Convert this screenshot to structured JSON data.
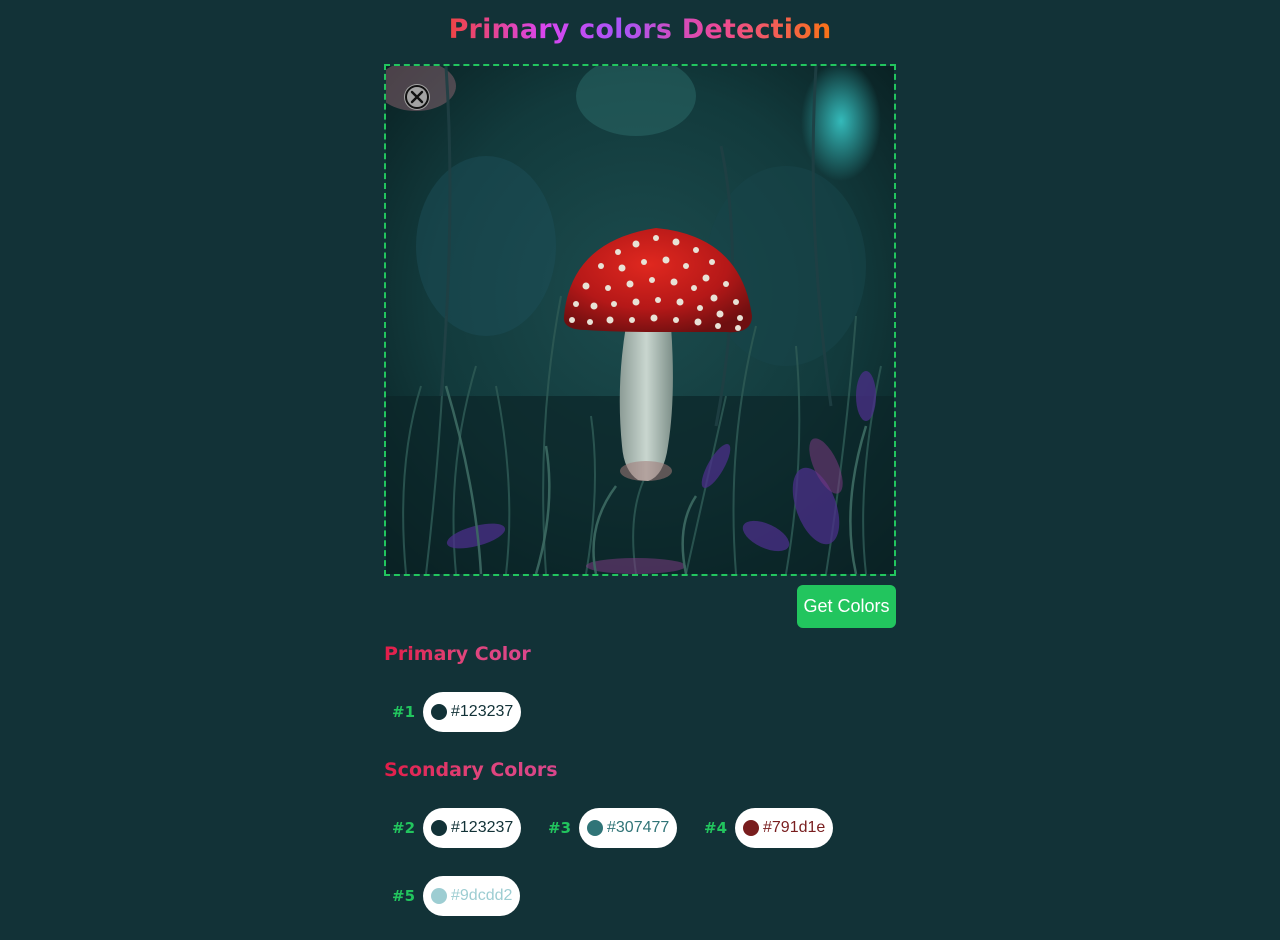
{
  "title": "Primary colors Detection",
  "upload": {
    "remove_icon": "close-icon",
    "image_subject": "red-mushroom-in-forest"
  },
  "actions": {
    "get_colors_label": "Get Colors"
  },
  "primary": {
    "heading": "Primary Color",
    "items": [
      {
        "rank": "#1",
        "hex": "#123237",
        "color": "#123237"
      }
    ]
  },
  "secondary": {
    "heading": "Scondary Colors",
    "items": [
      {
        "rank": "#2",
        "hex": "#123237",
        "color": "#123237"
      },
      {
        "rank": "#3",
        "hex": "#307477",
        "color": "#307477"
      },
      {
        "rank": "#4",
        "hex": "#791d1e",
        "color": "#791d1e"
      },
      {
        "rank": "#5",
        "hex": "#9dcdd2",
        "color": "#9dcdd2"
      }
    ]
  },
  "colors": {
    "background": "#123237",
    "accent": "#22c55e",
    "chip_background": "#ffffff"
  }
}
